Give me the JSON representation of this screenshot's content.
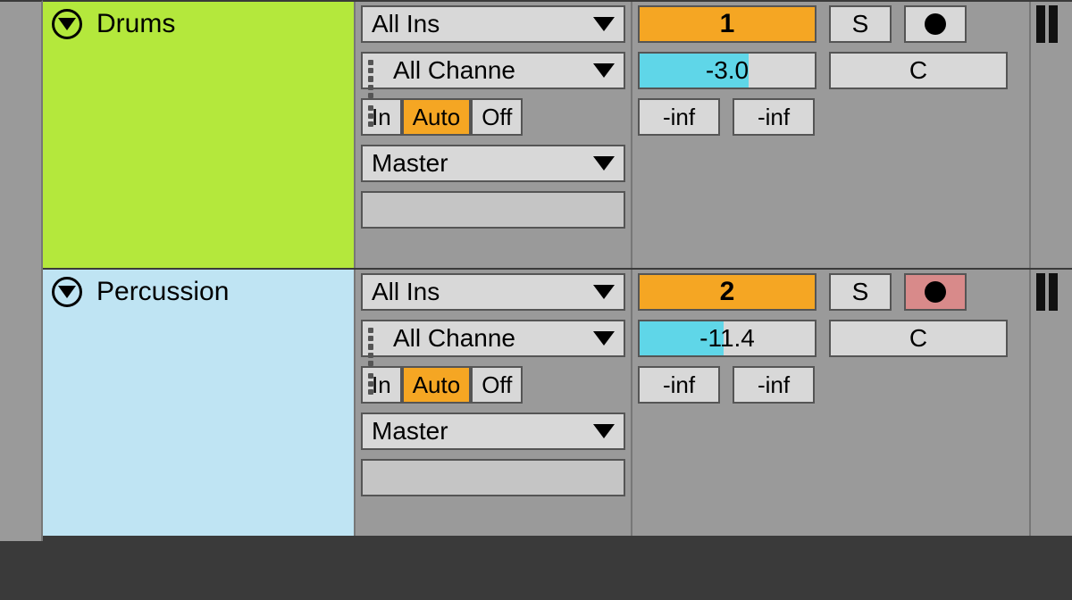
{
  "tracks": [
    {
      "name": "Drums",
      "color": "#b4e83c",
      "input_type": "All Ins",
      "input_channel": "All Channe",
      "monitor": {
        "in": "In",
        "auto": "Auto",
        "off": "Off",
        "active": "auto"
      },
      "output": "Master",
      "activator": "1",
      "solo": "S",
      "record_armed": false,
      "volume": "-3.0",
      "volume_fill_pct": 62,
      "pan": "C",
      "sends": [
        "-inf",
        "-inf"
      ]
    },
    {
      "name": "Percussion",
      "color": "#bfe4f3",
      "input_type": "All Ins",
      "input_channel": "All Channe",
      "monitor": {
        "in": "In",
        "auto": "Auto",
        "off": "Off",
        "active": "auto"
      },
      "output": "Master",
      "activator": "2",
      "solo": "S",
      "record_armed": true,
      "volume": "-11.4",
      "volume_fill_pct": 48,
      "pan": "C",
      "sends": [
        "-inf",
        "-inf"
      ]
    }
  ]
}
